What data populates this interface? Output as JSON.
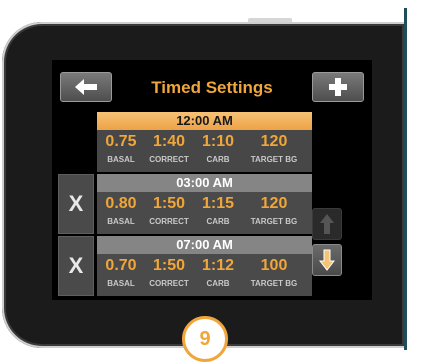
{
  "header": {
    "title": "Timed Settings"
  },
  "rows": [
    {
      "time": "12:00 AM",
      "values": {
        "basal": "0.75",
        "correct": "1:40",
        "carb": "1:10",
        "target_bg": "120"
      },
      "deletable": false
    },
    {
      "time": "03:00 AM",
      "values": {
        "basal": "0.80",
        "correct": "1:50",
        "carb": "1:15",
        "target_bg": "120"
      },
      "delete_label": "X"
    },
    {
      "time": "07:00 AM",
      "values": {
        "basal": "0.70",
        "correct": "1:50",
        "carb": "1:12",
        "target_bg": "100"
      },
      "delete_label": "X"
    }
  ],
  "labels": {
    "basal": "BASAL",
    "correct": "CORRECT",
    "carb": "CARB",
    "target_bg": "TARGET BG"
  },
  "step_badge": "9",
  "colors": {
    "accent": "#f0a63a",
    "screen_bg": "#000000",
    "row_bg": "#4a4a4a",
    "header_row": "#858585"
  },
  "icons": {
    "back": "left-arrow-icon",
    "add": "plus-icon",
    "scroll_up": "up-arrow-icon",
    "scroll_down": "down-arrow-icon"
  }
}
